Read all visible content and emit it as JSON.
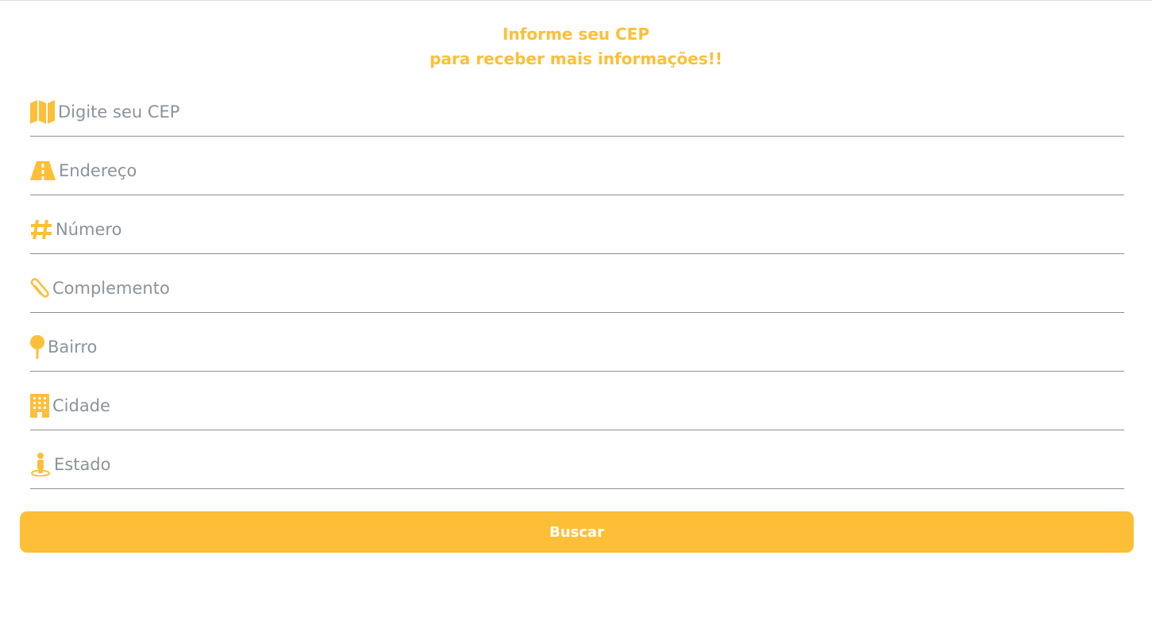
{
  "header": {
    "line1": "Informe seu CEP",
    "line2": "para receber mais informações!!"
  },
  "colors": {
    "accent": "#fdbf38",
    "placeholder": "#8a939c",
    "divider": "#8a8f95",
    "button_text": "#ffffff"
  },
  "fields": [
    {
      "icon": "map-icon",
      "placeholder": "Digite seu CEP",
      "value": ""
    },
    {
      "icon": "road-icon",
      "placeholder": "Endereço",
      "value": ""
    },
    {
      "icon": "hashtag-icon",
      "placeholder": "Número",
      "value": ""
    },
    {
      "icon": "paperclip-icon",
      "placeholder": "Complemento",
      "value": ""
    },
    {
      "icon": "map-pin-icon",
      "placeholder": "Bairro",
      "value": ""
    },
    {
      "icon": "building-icon",
      "placeholder": "Cidade",
      "value": ""
    },
    {
      "icon": "street-view-icon",
      "placeholder": "Estado",
      "value": ""
    }
  ],
  "button": {
    "label": "Buscar"
  }
}
